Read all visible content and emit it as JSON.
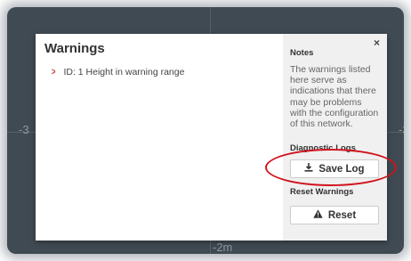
{
  "background": {
    "axis_labels": [
      "-3",
      "-3",
      "-2m"
    ]
  },
  "modal": {
    "title": "Warnings",
    "warnings": [
      {
        "text": "ID: 1 Height in warning range"
      }
    ],
    "close_label": "×",
    "notes": {
      "heading": "Notes",
      "text": "The warnings listed here serve as indications that there may be problems with the configuration of this network."
    },
    "diagnostic_logs": {
      "heading": "Diagnostic Logs",
      "save_button": "Save Log",
      "save_icon": "download-icon"
    },
    "reset_warnings": {
      "heading": "Reset Warnings",
      "reset_button": "Reset",
      "reset_icon": "warning-icon"
    }
  },
  "colors": {
    "accent": "#c0392b",
    "annotation_ellipse": "#d0131d",
    "backdrop": "#3f4a52"
  }
}
